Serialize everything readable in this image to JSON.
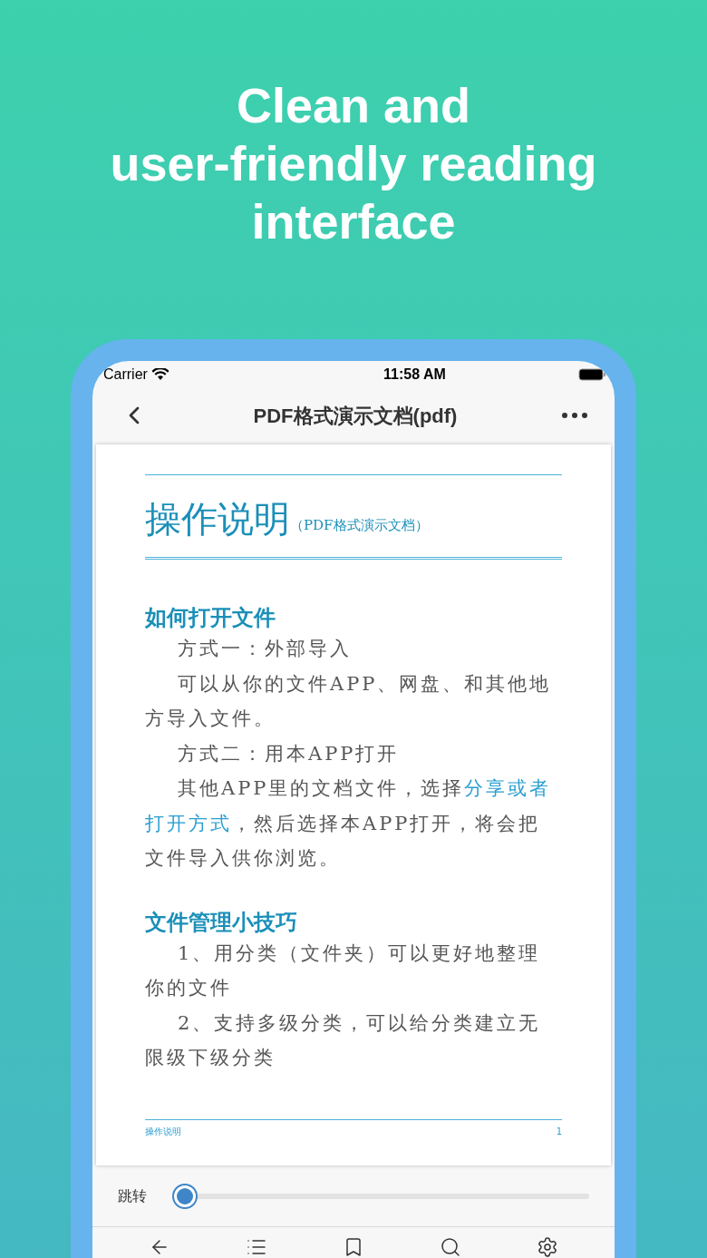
{
  "headline": [
    "Clean and",
    "user-friendly reading",
    "interface"
  ],
  "status_bar": {
    "carrier": "Carrier",
    "time": "11:58 AM"
  },
  "nav": {
    "title": "PDF格式演示文档(pdf)"
  },
  "document": {
    "title": "操作说明",
    "subtitle": "（PDF格式演示文档）",
    "sections": [
      {
        "heading": "如何打开文件",
        "paragraphs": [
          [
            [
              {
                "text": "方式一：外部导入",
                "highlight": false
              }
            ]
          ],
          [
            [
              {
                "text": "可以从你的文件APP、网盘、和其他地方导入文件。",
                "highlight": false
              }
            ]
          ],
          [
            [
              {
                "text": "方式二：用本APP打开",
                "highlight": false
              }
            ]
          ],
          [
            [
              {
                "text": "其他APP里的文档文件，选择",
                "highlight": false
              },
              {
                "text": "分享或者",
                "highlight": true
              }
            ],
            [
              {
                "text": "打开方式",
                "highlight": true
              },
              {
                "text": "，然后选择本APP打开，将会把",
                "highlight": false
              }
            ],
            [
              {
                "text": "文件导入供你浏览。",
                "highlight": false
              }
            ]
          ]
        ]
      },
      {
        "heading": "文件管理小技巧",
        "paragraphs": [
          [
            [
              {
                "text": "1、用分类（文件夹）可以更好地整理你的文件",
                "highlight": false
              }
            ]
          ],
          [
            [
              {
                "text": "2、支持多级分类，可以给分类建立无限级下级分类",
                "highlight": false
              }
            ]
          ]
        ]
      }
    ],
    "footer_title": "操作说明",
    "page_number": "1"
  },
  "jump": {
    "label": "跳转"
  },
  "toolbar": [
    {
      "kind": "back"
    },
    {
      "kind": "contents"
    },
    {
      "kind": "bookmark"
    },
    {
      "kind": "search"
    },
    {
      "kind": "settings"
    }
  ]
}
